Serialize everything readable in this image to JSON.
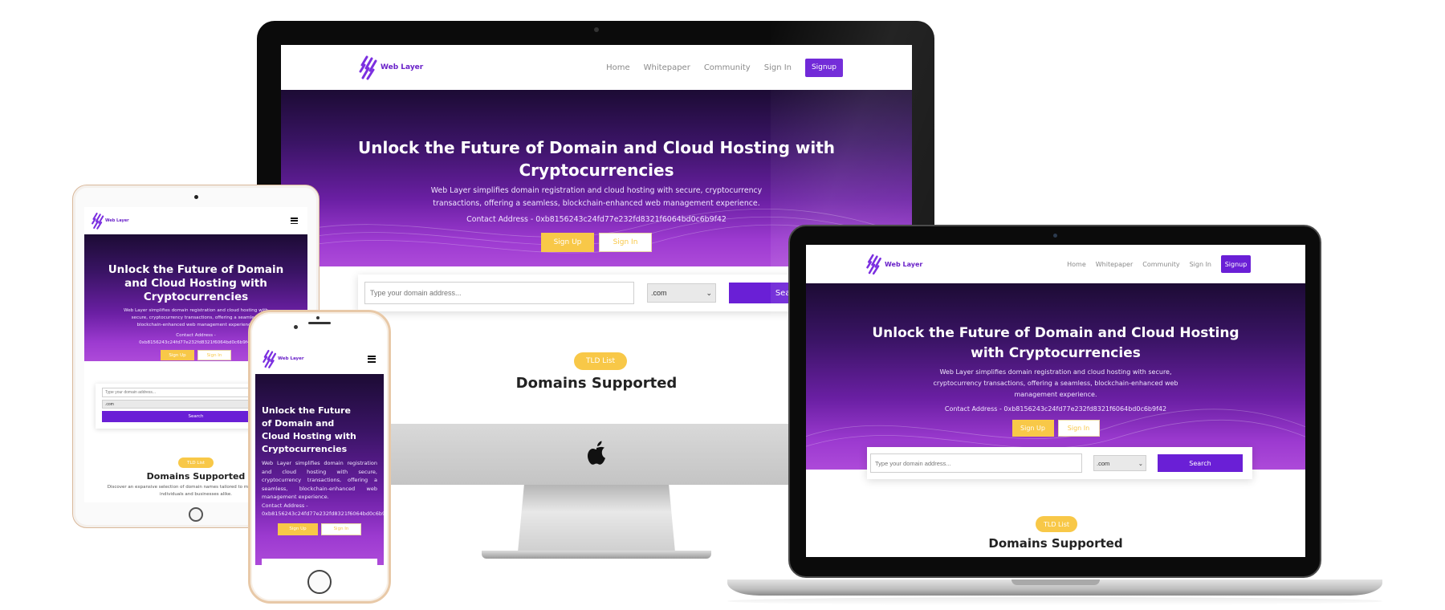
{
  "site": {
    "logo_text": "Web Layer",
    "nav": {
      "home": "Home",
      "whitepaper": "Whitepaper",
      "community": "Community",
      "signin": "Sign In",
      "signup": "Signup"
    },
    "hero": {
      "title": "Unlock the Future of Domain and Cloud Hosting with Cryptocurrencies",
      "description": "Web Layer simplifies domain registration and cloud hosting with secure, cryptocurrency transactions, offering a seamless, blockchain-enhanced web management experience.",
      "contact": "Contact Address - 0xb8156243c24fd77e232fd8321f6064bd0c6b9f42",
      "signup_button": "Sign Up",
      "signin_button": "Sign In"
    },
    "search": {
      "placeholder": "Type your domain address...",
      "tld_selected": ".com",
      "button": "Search"
    },
    "tld_badge": "TLD List",
    "section_title": "Domains Supported",
    "section_description": "Discover an expansive selection of domain names tailored to meet the needs of individuals and businesses alike."
  },
  "colors": {
    "accent": "#6a1fd6",
    "yellow": "#f8c848",
    "hero_dark": "#1c0b34",
    "hero_light": "#ad4ad9"
  },
  "devices": [
    "imac",
    "macbook",
    "ipad",
    "iphone"
  ]
}
